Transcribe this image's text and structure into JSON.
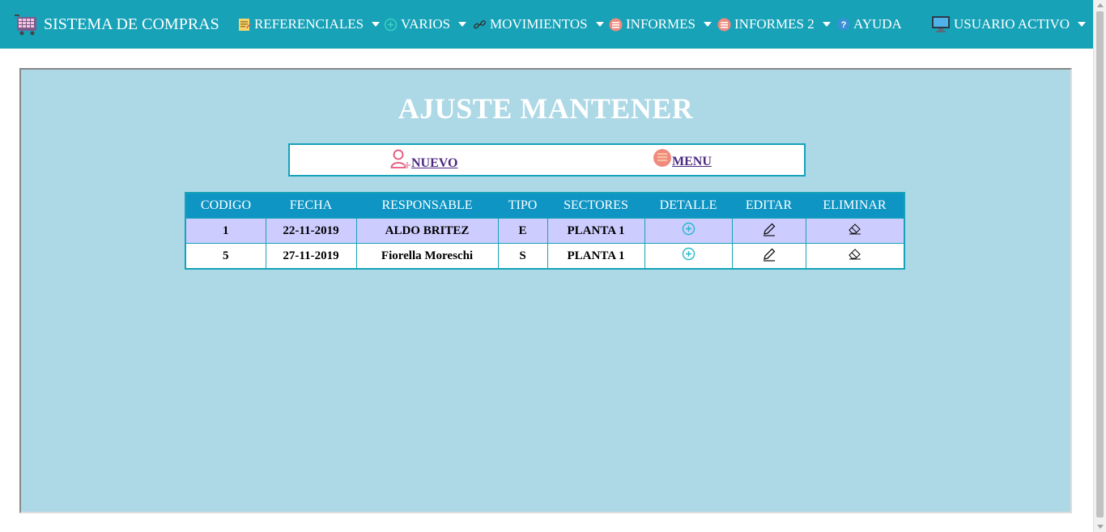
{
  "nav": {
    "brand": "SISTEMA DE COMPRAS",
    "items": [
      {
        "label": "REFERENCIALES",
        "icon": "notes-icon"
      },
      {
        "label": "VARIOS",
        "icon": "plus-circle-icon"
      },
      {
        "label": "MOVIMIENTOS",
        "icon": "link-icon"
      },
      {
        "label": "INFORMES",
        "icon": "report-icon"
      },
      {
        "label": "INFORMES 2",
        "icon": "report-icon"
      },
      {
        "label": "AYUDA",
        "icon": "help-icon"
      }
    ],
    "user": "USUARIO ACTIVO"
  },
  "page": {
    "title": "AJUSTE MANTENER",
    "actions": {
      "new_label": "NUEVO",
      "menu_label": "MENU"
    }
  },
  "table": {
    "headers": [
      "CODIGO",
      "FECHA",
      "RESPONSABLE",
      "TIPO",
      "SECTORES",
      "DETALLE",
      "EDITAR",
      "ELIMINAR"
    ],
    "rows": [
      {
        "codigo": "1",
        "fecha": "22-11-2019",
        "responsable": "ALDO BRITEZ",
        "tipo": "E",
        "sectores": "PLANTA 1"
      },
      {
        "codigo": "5",
        "fecha": "27-11-2019",
        "responsable": "Fiorella Moreschi",
        "tipo": "S",
        "sectores": "PLANTA 1"
      }
    ]
  },
  "colors": {
    "navbar": "#17a2b8",
    "panel": "#add8e6",
    "header_row": "#0f95c4",
    "row_highlight": "#ccccff",
    "link": "#4b2a80"
  }
}
